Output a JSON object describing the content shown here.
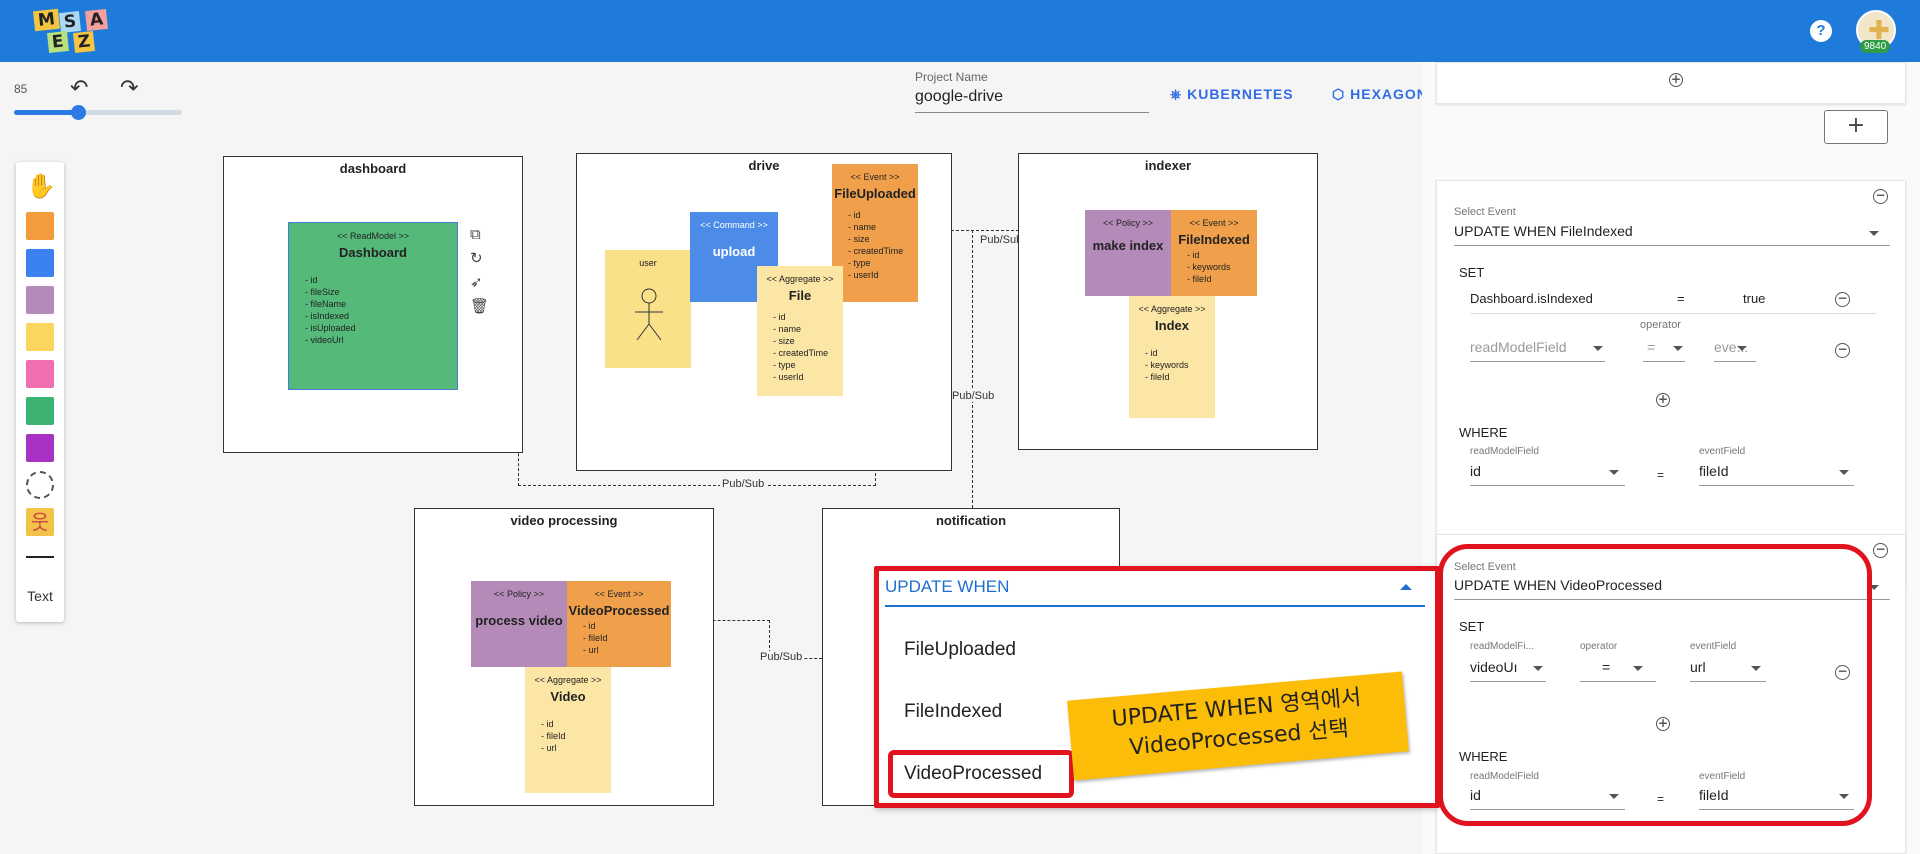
{
  "app": {
    "logo_letters": [
      "M",
      "S",
      "A",
      "E",
      "Z"
    ],
    "credits": "9840",
    "help_label": "?"
  },
  "toolbar": {
    "zoom": "85",
    "zoom_level": 0.38,
    "undo_label": "↶",
    "redo_label": "↷"
  },
  "palette": {
    "colors": [
      "#f39c3d",
      "#3b82f0",
      "#b48bb8",
      "#fbd65e",
      "#f06fae",
      "#3cb371",
      "#a832c3"
    ],
    "text_label": "Text",
    "icons": [
      "hand-icon",
      "boundary-icon",
      "actor-icon",
      "line-icon"
    ]
  },
  "project": {
    "name_label": "Project Name",
    "name": "google-drive",
    "kubernetes": "KUBERNETES",
    "hexagonal": "HEXAGONAL"
  },
  "canvas": {
    "contexts": {
      "dashboard": "dashboard",
      "drive": "drive",
      "indexer": "indexer",
      "video": "video processing",
      "notification": "notification"
    },
    "readmodel": {
      "stereo": "<< ReadModel >>",
      "name": "Dashboard",
      "fields": [
        "id",
        "fileSize",
        "fileName",
        "isIndexed",
        "isUploaded",
        "videoUrl"
      ]
    },
    "drive_user": "user",
    "drive_command": {
      "stereo": "<< Command >>",
      "name": "upload"
    },
    "drive_event": {
      "stereo": "<< Event >>",
      "name": "FileUploaded",
      "fields": [
        "id",
        "name",
        "size",
        "createdTime",
        "type",
        "userId"
      ]
    },
    "drive_aggregate": {
      "stereo": "<< Aggregate >>",
      "name": "File",
      "fields": [
        "id",
        "name",
        "size",
        "createdTime",
        "type",
        "userId"
      ]
    },
    "indexer_policy": {
      "stereo": "<< Policy >>",
      "name": "make index"
    },
    "indexer_event": {
      "stereo": "<< Event >>",
      "name": "FileIndexed",
      "fields": [
        "id",
        "keywords",
        "fileId"
      ]
    },
    "indexer_aggregate": {
      "stereo": "<< Aggregate >>",
      "name": "Index",
      "fields": [
        "id",
        "keywords",
        "fileId"
      ]
    },
    "video_policy": {
      "stereo": "<< Policy >>",
      "name": "process video"
    },
    "video_event": {
      "stereo": "<< Event >>",
      "name": "VideoProcessed",
      "fields": [
        "id",
        "fileId",
        "url"
      ]
    },
    "video_aggregate": {
      "stereo": "<< Aggregate >>",
      "name": "Video",
      "fields": [
        "id",
        "fileId",
        "url"
      ]
    },
    "pubsub": "Pub/Sub"
  },
  "panel": {
    "add_label": "+",
    "card1": {
      "select_label": "Select Event",
      "select_value": "UPDATE WHEN FileIndexed",
      "set_label": "SET",
      "set_field": "Dashboard.isIndexed",
      "set_eq": "=",
      "set_value": "true",
      "operator_label": "operator",
      "rm_placeholder": "readModelField",
      "op_placeholder": "=",
      "ev_placeholder": "eve...",
      "where_label": "WHERE",
      "where_rm_label": "readModelField",
      "where_rm": "id",
      "where_eq": "=",
      "where_ev_label": "eventField",
      "where_ev": "fileId"
    },
    "card2": {
      "select_label": "Select Event",
      "select_value": "UPDATE WHEN VideoProcessed",
      "set_label": "SET",
      "rm_label": "readModelFi...",
      "rm_value": "videoUı",
      "op_label": "operator",
      "op_value": "=",
      "ev_label": "eventField",
      "ev_value": "url",
      "where_label": "WHERE",
      "where_rm_label": "readModelField",
      "where_rm": "id",
      "where_eq": "=",
      "where_ev_label": "eventField",
      "where_ev": "fileId"
    }
  },
  "dropdown": {
    "header": "UPDATE WHEN",
    "options": [
      "FileUploaded",
      "FileIndexed",
      "VideoProcessed"
    ]
  },
  "callout": {
    "line1": "UPDATE WHEN 영역에서",
    "line2": "VideoProcessed 선택"
  }
}
